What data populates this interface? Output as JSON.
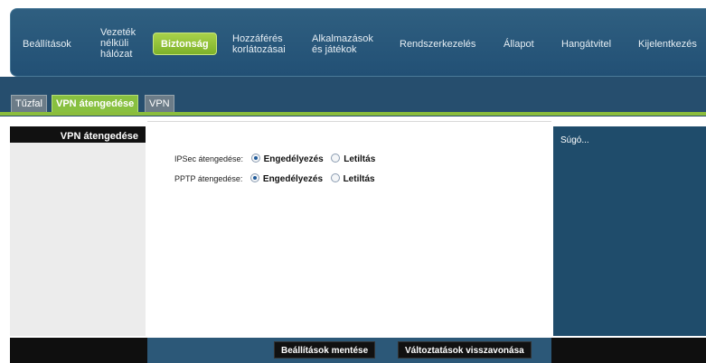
{
  "nav": {
    "items": [
      {
        "label": "Beállítások"
      },
      {
        "line1": "Vezeték",
        "line2": "nélküli",
        "line3": "hálózat"
      },
      {
        "label": "Biztonság"
      },
      {
        "line1": "Hozzáférés",
        "line2": "korlátozásai"
      },
      {
        "line1": "Alkalmazások",
        "line2": "és játékok"
      },
      {
        "label": "Rendszerkezelés"
      },
      {
        "label": "Állapot"
      },
      {
        "label": "Hangátvitel"
      },
      {
        "label": "Kijelentkezés"
      }
    ]
  },
  "tabs": [
    "Tűzfal",
    "VPN átengedése",
    "VPN"
  ],
  "sidebar": {
    "title": "VPN átengedése"
  },
  "form": {
    "rows": [
      {
        "label": "IPSec átengedése:",
        "enable": "Engedélyezés",
        "disable": "Letiltás",
        "selected": "enable"
      },
      {
        "label": "PPTP átengedése:",
        "enable": "Engedélyezés",
        "disable": "Letiltás",
        "selected": "enable"
      }
    ]
  },
  "help": {
    "text": "Súgó..."
  },
  "footer": {
    "save": "Beállítások mentése",
    "cancel": "Változtatások visszavonása"
  },
  "colors": {
    "accent": "#88c040",
    "nav_bg": "#2a5878",
    "help_bg": "#1f4c6b"
  }
}
